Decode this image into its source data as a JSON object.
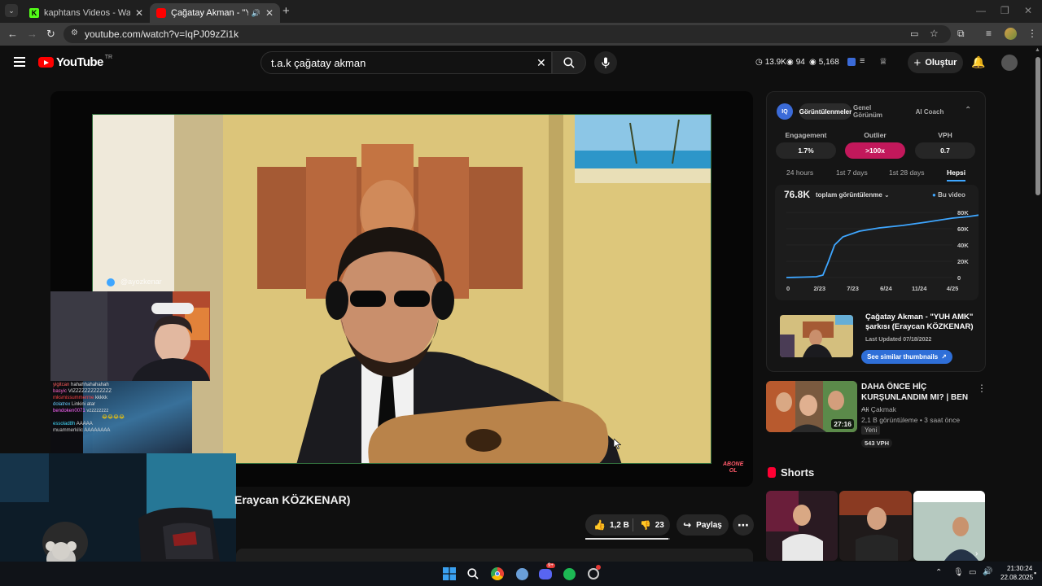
{
  "browser": {
    "tabs": [
      {
        "title": "kaphtans Videos - Watch On-D",
        "favicon_color": "#53fc18"
      },
      {
        "title": "Çağatay Akman - \"YUH AM",
        "favicon_color": "#ff0000"
      }
    ],
    "url": "youtube.com/watch?v=IqPJ09zZi1k"
  },
  "youtube": {
    "logo_text": "YouTube",
    "region": "TR",
    "search_query": "t.a.k çağatay akman",
    "stats": {
      "views": "13.9K",
      "likes": "94",
      "watched": "5,168"
    },
    "create_label": "Oluştur"
  },
  "player": {
    "watermark": "@ayozkenar",
    "subscribe_badge_line1": "ABONE",
    "subscribe_badge_line2": "OL"
  },
  "stream_chat": [
    {
      "user": "yigitcan",
      "text": "hahahhahahahah",
      "color": "#ff5c5c"
    },
    {
      "user": "basyic",
      "text": "VIZZZZZZZZZZZZZ",
      "color": "#ff66cc"
    },
    {
      "user": "mksmissummerme",
      "text": "kkkkk",
      "color": "#ff4444"
    },
    {
      "user": "dolatrex",
      "text": "Linkini atar",
      "color": "#66ccff"
    },
    {
      "user": "bendoken0071",
      "text": "vzzzzzzzz",
      "color": "#ff66ff"
    },
    {
      "user": "",
      "text": "😂😂😂😂",
      "color": "#ffcc00"
    },
    {
      "user": "essolad8h",
      "text": "AAAAA",
      "color": "#44ddff"
    },
    {
      "user": "muammerkilic",
      "text": "AAAAAAAA",
      "color": "#cccccc"
    }
  ],
  "video": {
    "title_visible": "Eraycan KÖZKENAR)",
    "likes": "1,2 B",
    "dislikes": "23",
    "share_label": "Paylaş"
  },
  "iq_panel": {
    "badge": "IQ",
    "tabs": [
      "Görüntülenmeler",
      "Genel Görünüm",
      "AI Coach"
    ],
    "metrics": [
      {
        "label": "Engagement",
        "value": "1.7%"
      },
      {
        "label": "Outlier",
        "value": ">100x",
        "color": "#c2185b"
      },
      {
        "label": "VPH",
        "value": "0.7"
      }
    ],
    "ranges": [
      "24 hours",
      "1st 7 days",
      "1st 28 days",
      "Hepsi"
    ],
    "chart_total": "76.8K",
    "chart_dropdown": "toplam görüntülenme",
    "chart_legend": "Bu video",
    "similar": {
      "title": "Çağatay Akman - \"YUH AMK\" şarkısı (Eraycan KÖZKENAR)",
      "updated": "Last Updated 07/18/2022",
      "button": "See similar thumbnails"
    }
  },
  "chart_data": {
    "type": "line",
    "x_ticks": [
      "0",
      "2/23",
      "7/23",
      "6/24",
      "11/24",
      "4/25"
    ],
    "y_ticks": [
      "0",
      "20K",
      "40K",
      "60K",
      "80K"
    ],
    "ylim": [
      0,
      80000
    ],
    "series": [
      {
        "name": "Bu video",
        "color": "#3ea6ff",
        "points": [
          [
            0,
            0
          ],
          [
            0.2,
            200
          ],
          [
            0.5,
            500
          ],
          [
            0.9,
            1000
          ],
          [
            1.1,
            3000
          ],
          [
            1.25,
            18000
          ],
          [
            1.45,
            40000
          ],
          [
            1.7,
            50000
          ],
          [
            2.2,
            57000
          ],
          [
            2.8,
            61000
          ],
          [
            3.5,
            64000
          ],
          [
            4.2,
            68000
          ],
          [
            5,
            73000
          ],
          [
            5.5,
            75000
          ],
          [
            5.8,
            76800
          ]
        ]
      }
    ]
  },
  "recommended": {
    "title": "DAHA ÖNCE HİÇ KURŞUNLANDIM MI? | BEN ...",
    "channel": "Ali Çakmak",
    "meta": "2,1 B görüntüleme • 3 saat önce",
    "badge_new": "Yeni",
    "vph": "543 VPH",
    "duration": "27:16"
  },
  "shorts": {
    "label": "Shorts"
  },
  "taskbar": {
    "time": "21:30:24",
    "date": "22.08.2025",
    "discord_badge": "9+"
  }
}
